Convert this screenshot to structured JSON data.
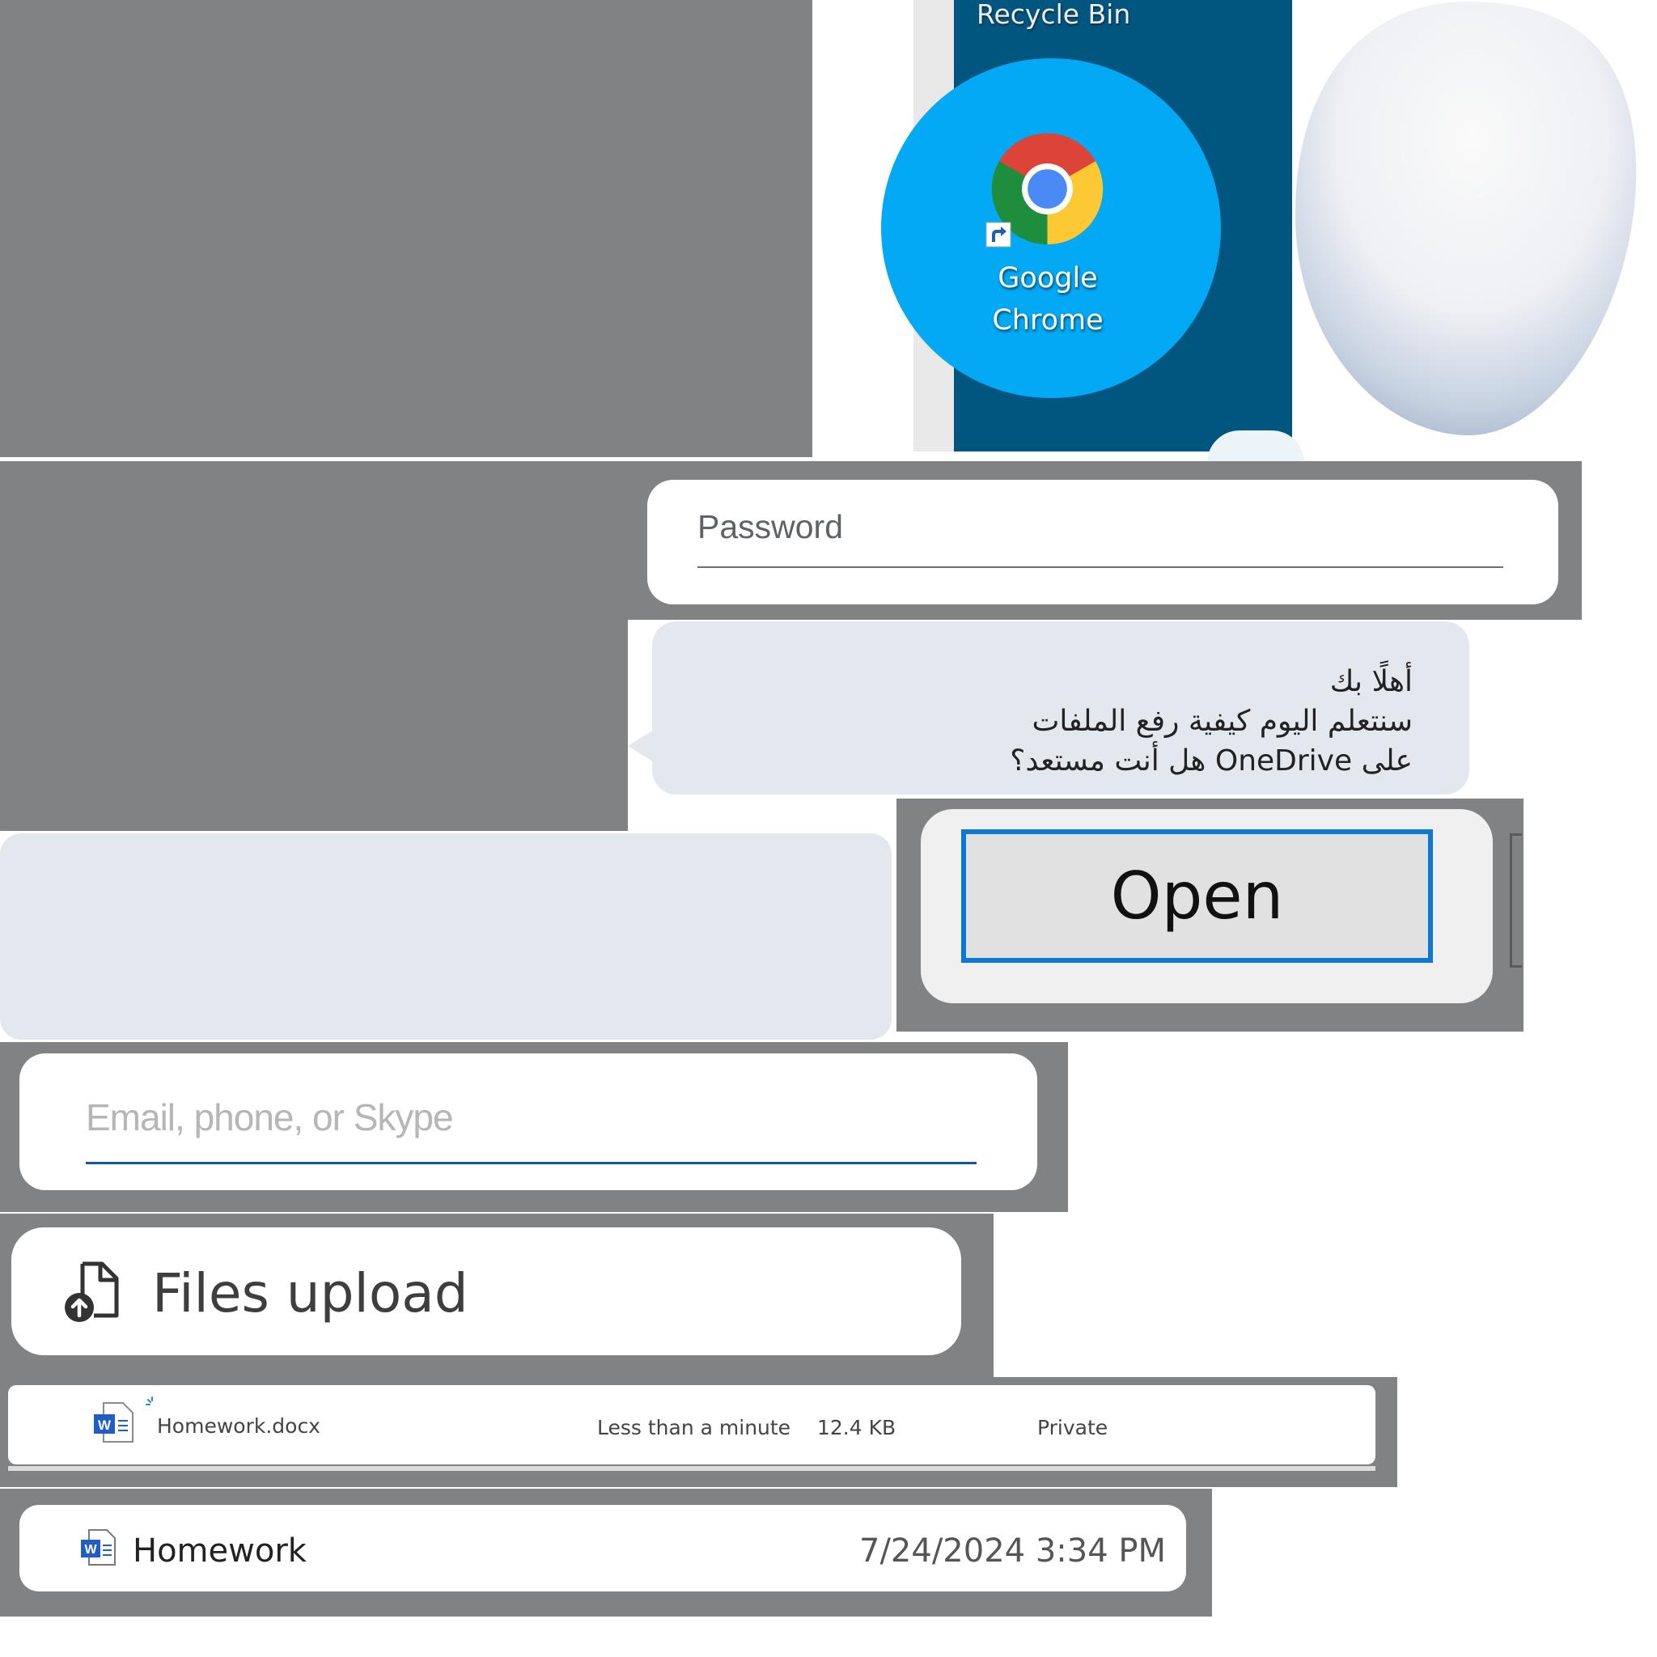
{
  "desktop": {
    "recycle_bin_label": "Recycle Bin",
    "chrome_label_line1": "Google",
    "chrome_label_line2": "Chrome"
  },
  "password_field": {
    "placeholder": "Password"
  },
  "welcome_bubble": {
    "line1": "أهلًا بك",
    "line2": "سنتعلم اليوم كيفية رفع الملفات",
    "line3": "على OneDrive هل أنت مستعد؟"
  },
  "open_button": {
    "label": "Open",
    "accent": "#0a78d4"
  },
  "email_field": {
    "placeholder": "Email, phone, or Skype"
  },
  "files_upload": {
    "label": "Files upload",
    "icon": "file-upload-icon"
  },
  "file_row": {
    "name": "Homework.docx",
    "modified": "Less than a minute ag",
    "size": "12.4 KB",
    "sharing": "Private",
    "icon": "word-doc-icon"
  },
  "recent_item": {
    "name": "Homework",
    "date": "7/24/2024 3:34 PM",
    "icon": "word-doc-icon"
  },
  "colors": {
    "desktop_bg": "#00567e",
    "circle_bg": "#03a9f4",
    "bubble_bg": "#e3e8ef",
    "panel_gray": "#818283"
  }
}
